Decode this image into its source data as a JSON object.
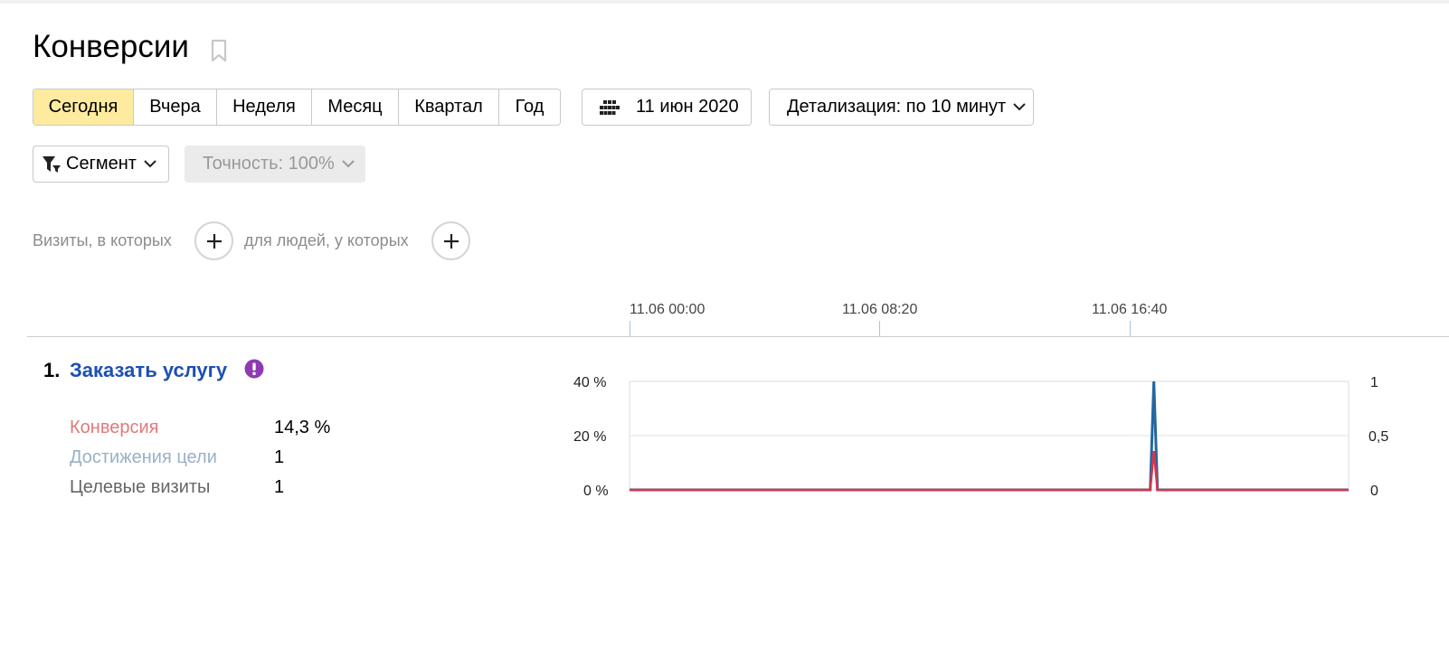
{
  "page": {
    "title": "Конверсии",
    "bookmark_icon": "bookmark-icon"
  },
  "periods": [
    {
      "label": "Сегодня",
      "active": true
    },
    {
      "label": "Вчера",
      "active": false
    },
    {
      "label": "Неделя",
      "active": false
    },
    {
      "label": "Месяц",
      "active": false
    },
    {
      "label": "Квартал",
      "active": false
    },
    {
      "label": "Год",
      "active": false
    }
  ],
  "date_picker": {
    "label": "11 июн 2020",
    "icon": "calendar-icon"
  },
  "detail": {
    "label": "Детализация: по 10 минут"
  },
  "segment": {
    "label": "Сегмент",
    "icon": "filter-icon"
  },
  "accuracy": {
    "label": "Точность: 100%"
  },
  "conditions": {
    "visits_label": "Визиты, в которых",
    "people_label": "для людей, у которых"
  },
  "timeline": {
    "ticks": [
      "11.06 00:00",
      "11.06 08:20",
      "11.06 16:40"
    ]
  },
  "goal": {
    "number": "1.",
    "name": "Заказать услугу",
    "alert_icon": "exclamation-icon",
    "metrics": [
      {
        "label": "Конверсия",
        "value": "14,3 %",
        "color": "#e07a7a"
      },
      {
        "label": "Достижения цели",
        "value": "1",
        "color": "#9ab0c8"
      },
      {
        "label": "Целевые визиты",
        "value": "1",
        "color": "#666666"
      }
    ]
  },
  "colors": {
    "active_period": "#ffeba0",
    "link": "#1d4fb5",
    "conversion_line": "#d9344a",
    "goal_line": "#2467a0",
    "alert": "#8e3bb3"
  },
  "chart_data": {
    "type": "line",
    "y_left_ticks": [
      "40 %",
      "20 %",
      "0 %"
    ],
    "y_right_ticks": [
      "1",
      "0,5",
      "0"
    ],
    "ylim_left": [
      0,
      40
    ],
    "ylim_right": [
      0,
      1
    ],
    "x_range_hours": [
      0,
      24
    ],
    "series": [
      {
        "axis": "right",
        "peak_x_hours": 17.5,
        "peak_y": 1,
        "baseline": 0
      },
      {
        "axis": "left",
        "peak_x_hours": 17.5,
        "peak_y": 14.3,
        "baseline": 0
      }
    ]
  }
}
